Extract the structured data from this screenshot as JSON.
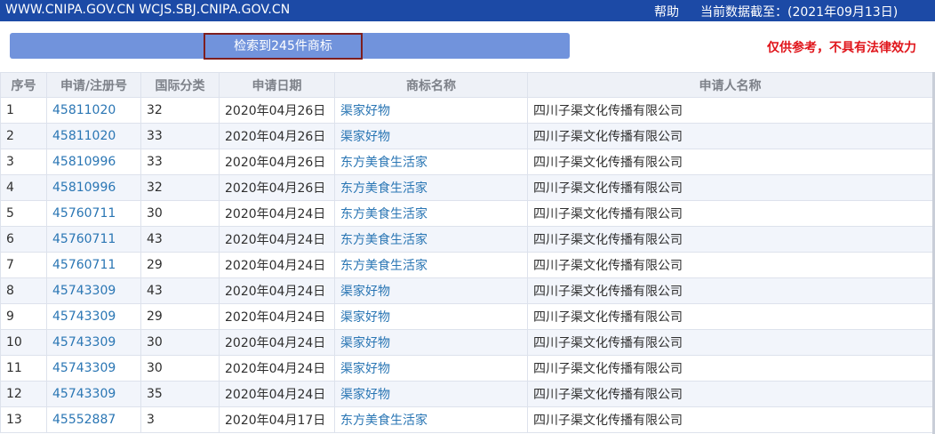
{
  "header": {
    "site": "WWW.CNIPA.GOV.CN WCJS.SBJ.CNIPA.GOV.CN",
    "help": "帮助",
    "date_label": "当前数据截至：(2021年09月13日)"
  },
  "search": {
    "result_label": "检索到245件商标"
  },
  "disclaimer": "仅供参考，不具有法律效力",
  "table": {
    "headers": [
      "序号",
      "申请/注册号",
      "国际分类",
      "申请日期",
      "商标名称",
      "申请人名称"
    ],
    "rows": [
      {
        "no": "1",
        "reg": "45811020",
        "cls": "32",
        "date": "2020年04月26日",
        "name": "渠家好物",
        "applicant": "四川子渠文化传播有限公司"
      },
      {
        "no": "2",
        "reg": "45811020",
        "cls": "33",
        "date": "2020年04月26日",
        "name": "渠家好物",
        "applicant": "四川子渠文化传播有限公司"
      },
      {
        "no": "3",
        "reg": "45810996",
        "cls": "33",
        "date": "2020年04月26日",
        "name": "东方美食生活家",
        "applicant": "四川子渠文化传播有限公司"
      },
      {
        "no": "4",
        "reg": "45810996",
        "cls": "32",
        "date": "2020年04月26日",
        "name": "东方美食生活家",
        "applicant": "四川子渠文化传播有限公司"
      },
      {
        "no": "5",
        "reg": "45760711",
        "cls": "30",
        "date": "2020年04月24日",
        "name": "东方美食生活家",
        "applicant": "四川子渠文化传播有限公司"
      },
      {
        "no": "6",
        "reg": "45760711",
        "cls": "43",
        "date": "2020年04月24日",
        "name": "东方美食生活家",
        "applicant": "四川子渠文化传播有限公司"
      },
      {
        "no": "7",
        "reg": "45760711",
        "cls": "29",
        "date": "2020年04月24日",
        "name": "东方美食生活家",
        "applicant": "四川子渠文化传播有限公司"
      },
      {
        "no": "8",
        "reg": "45743309",
        "cls": "43",
        "date": "2020年04月24日",
        "name": "渠家好物",
        "applicant": "四川子渠文化传播有限公司"
      },
      {
        "no": "9",
        "reg": "45743309",
        "cls": "29",
        "date": "2020年04月24日",
        "name": "渠家好物",
        "applicant": "四川子渠文化传播有限公司"
      },
      {
        "no": "10",
        "reg": "45743309",
        "cls": "30",
        "date": "2020年04月24日",
        "name": "渠家好物",
        "applicant": "四川子渠文化传播有限公司"
      },
      {
        "no": "11",
        "reg": "45743309",
        "cls": "30",
        "date": "2020年04月24日",
        "name": "渠家好物",
        "applicant": "四川子渠文化传播有限公司"
      },
      {
        "no": "12",
        "reg": "45743309",
        "cls": "35",
        "date": "2020年04月24日",
        "name": "渠家好物",
        "applicant": "四川子渠文化传播有限公司"
      },
      {
        "no": "13",
        "reg": "45552887",
        "cls": "3",
        "date": "2020年04月17日",
        "name": "东方美食生活家",
        "applicant": "四川子渠文化传播有限公司"
      }
    ]
  }
}
